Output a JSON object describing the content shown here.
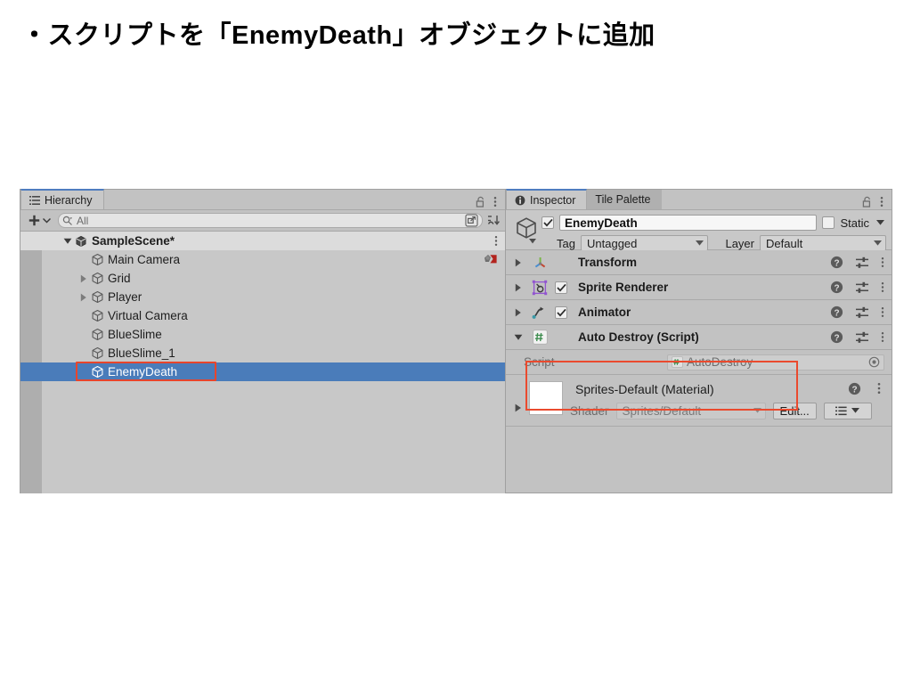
{
  "slide": {
    "title": "・スクリプトを「EnemyDeath」オブジェクトに追加"
  },
  "hierarchy": {
    "tab_label": "Hierarchy",
    "tab_icon": "hierarchy-list-icon",
    "lock_icon": "lock-open-icon",
    "menu_icon": "kebab-menu-icon",
    "toolbar": {
      "add_label": "+",
      "add_caret": "▾",
      "search_icon": "search-icon",
      "search_value": "",
      "search_placeholder": "All",
      "search_expand_icon": "popout-window-icon",
      "sort_icon": "sort-alpha-icon"
    },
    "items": [
      {
        "label": "SampleScene*",
        "icon": "unity-scene-icon",
        "indent": 0,
        "arrow": "▼",
        "selected": false,
        "scene": true,
        "overlay": "",
        "menu": "kebab-menu-icon"
      },
      {
        "label": "Main Camera",
        "icon": "gameobject-cube-icon",
        "indent": 1,
        "arrow": "",
        "selected": false,
        "scene": false,
        "overlay": "camera-gizmo-icon",
        "menu": ""
      },
      {
        "label": "Grid",
        "icon": "gameobject-cube-icon",
        "indent": 1,
        "arrow": "▶",
        "selected": false,
        "scene": false,
        "overlay": "",
        "menu": ""
      },
      {
        "label": "Player",
        "icon": "gameobject-cube-icon",
        "indent": 1,
        "arrow": "▶",
        "selected": false,
        "scene": false,
        "overlay": "",
        "menu": ""
      },
      {
        "label": "Virtual Camera",
        "icon": "gameobject-cube-icon",
        "indent": 1,
        "arrow": "",
        "selected": false,
        "scene": false,
        "overlay": "",
        "menu": ""
      },
      {
        "label": "BlueSlime",
        "icon": "gameobject-cube-icon",
        "indent": 1,
        "arrow": "",
        "selected": false,
        "scene": false,
        "overlay": "",
        "menu": ""
      },
      {
        "label": "BlueSlime_1",
        "icon": "gameobject-cube-icon",
        "indent": 1,
        "arrow": "",
        "selected": false,
        "scene": false,
        "overlay": "",
        "menu": ""
      },
      {
        "label": "EnemyDeath",
        "icon": "gameobject-cube-icon",
        "indent": 1,
        "arrow": "",
        "selected": true,
        "scene": false,
        "overlay": "",
        "menu": ""
      }
    ]
  },
  "inspector": {
    "tabs": [
      {
        "label": "Inspector",
        "icon": "info-circle-icon",
        "active": true
      },
      {
        "label": "Tile Palette",
        "icon": "",
        "active": false
      }
    ],
    "lock_icon": "lock-open-icon",
    "menu_icon": "kebab-menu-icon",
    "header": {
      "object_icon": "gameobject-cube-icon",
      "enabled_checkbox": true,
      "check_glyph": "✓",
      "name_value": "EnemyDeath",
      "static_checkbox": false,
      "static_label": "Static",
      "static_caret": "▾",
      "tag_label": "Tag",
      "tag_value": "Untagged",
      "layer_label": "Layer",
      "layer_value": "Default",
      "caret": "▾"
    },
    "components": [
      {
        "name": "Transform",
        "icon": "transform-axis-icon",
        "fold": "▶",
        "has_checkbox": false,
        "checked": false,
        "help_icon": "help-circle-icon",
        "preset_icon": "preset-sliders-icon",
        "menu_icon": "kebab-menu-icon",
        "highlighted": false
      },
      {
        "name": "Sprite Renderer",
        "icon": "sprite-renderer-icon",
        "fold": "▶",
        "has_checkbox": true,
        "checked": true,
        "help_icon": "help-circle-icon",
        "preset_icon": "preset-sliders-icon",
        "menu_icon": "kebab-menu-icon",
        "highlighted": false
      },
      {
        "name": "Animator",
        "icon": "animator-icon",
        "fold": "▶",
        "has_checkbox": true,
        "checked": true,
        "help_icon": "help-circle-icon",
        "preset_icon": "preset-sliders-icon",
        "menu_icon": "kebab-menu-icon",
        "highlighted": false
      },
      {
        "name": "Auto Destroy (Script)",
        "icon": "csharp-script-icon",
        "fold": "▼",
        "has_checkbox": false,
        "checked": false,
        "help_icon": "help-circle-icon",
        "preset_icon": "preset-sliders-icon",
        "menu_icon": "kebab-menu-icon",
        "highlighted": true
      }
    ],
    "script_row": {
      "label": "Script",
      "value": "AutoDestroy",
      "value_icon": "csharp-script-icon",
      "picker_icon": "object-picker-icon"
    },
    "material": {
      "title": "Sprites-Default (Material)",
      "swatch_color": "#ffffff",
      "fold": "▶",
      "shader_label": "Shader",
      "shader_value": "Sprites/Default",
      "shader_caret": "▾",
      "edit_label": "Edit...",
      "help_icon": "help-circle-icon",
      "menu_icon": "kebab-menu-icon",
      "list_icon": "list-lines-icon",
      "list_caret": "▾"
    }
  },
  "annotations": {
    "highlight_color": "#ea4a2e",
    "selection_color": "#4a7cba"
  }
}
